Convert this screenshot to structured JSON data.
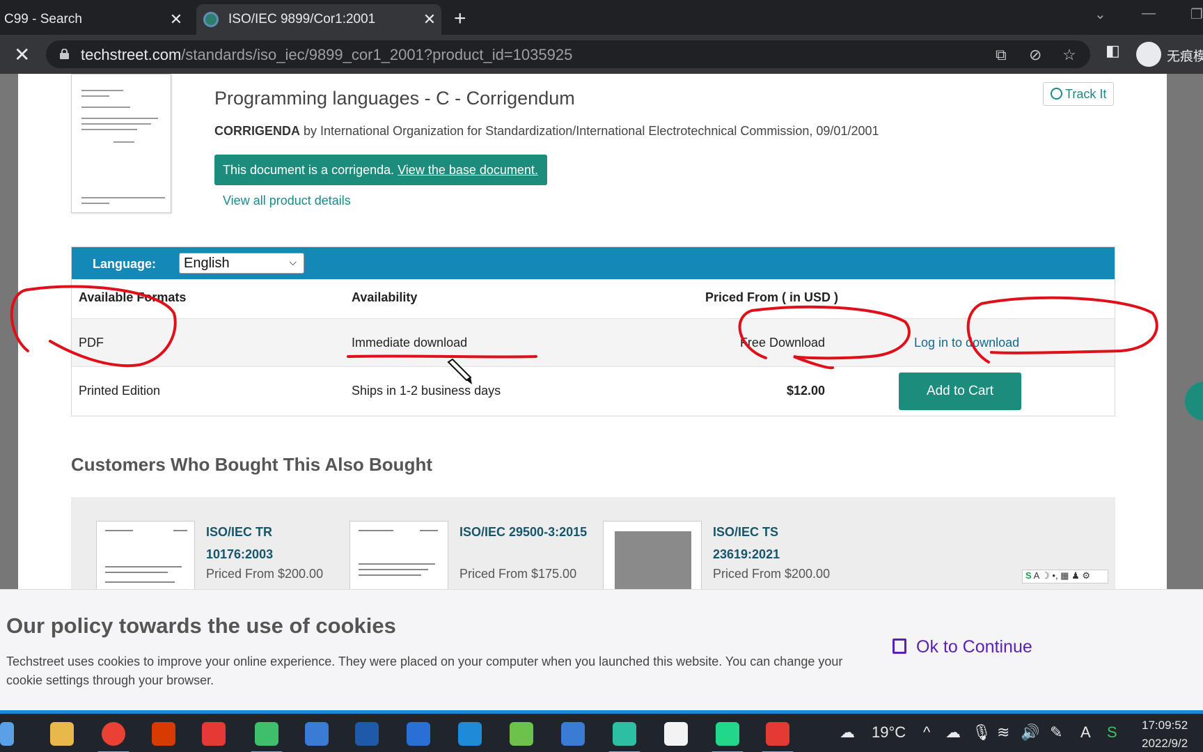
{
  "browser": {
    "tabs": [
      {
        "title": "C99 - Search",
        "active": false
      },
      {
        "title": "ISO/IEC 9899/Cor1:2001",
        "active": true
      }
    ],
    "url_host": "techstreet.com",
    "url_path": "/standards/iso_iec/9899_cor1_2001?product_id=1035925",
    "profile_label": "无痕模"
  },
  "product": {
    "title": "Programming languages - C - Corrigendum",
    "type": "CORRIGENDA",
    "byline": " by International Organization for Standardization/International Electrotechnical Commission, 09/01/2001",
    "banner_text": "This document is a corrigenda. ",
    "banner_link": "View the base document.",
    "details_link": "View all product details",
    "track_label": "Track It"
  },
  "formats": {
    "language_label": "Language:",
    "language_value": "English",
    "headers": [
      "Available Formats",
      "Availability",
      "Priced From ( in USD )"
    ],
    "rows": [
      {
        "format": "PDF",
        "availability": "Immediate download",
        "price": "Free Download",
        "action": "Log in to download"
      },
      {
        "format": "Printed Edition",
        "availability": "Ships in 1-2 business days",
        "price": "$12.00",
        "action": "Add to Cart"
      }
    ]
  },
  "also_bought": {
    "title": "Customers Who Bought This Also Bought",
    "items": [
      {
        "name": "ISO/IEC TR 10176:2003",
        "price": "Priced From $200.00"
      },
      {
        "name": "ISO/IEC 29500-3:2015",
        "price": "Priced From $175.00"
      },
      {
        "name": "ISO/IEC TS 23619:2021",
        "price": "Priced From $200.00"
      }
    ]
  },
  "cookie": {
    "title": "Our policy towards the use of cookies",
    "text": "Techstreet uses cookies to improve your online experience. They were placed on your computer when you launched this website. You can change your cookie settings through your browser.",
    "button": "Ok to Continue"
  },
  "taskbar": {
    "weather": "19°C",
    "time": "17:09:52",
    "date": "2022/9/2"
  },
  "colors": {
    "teal": "#1c8c7c",
    "language_bar": "#1489b8",
    "annotation_red": "#e0101a",
    "ok_purple": "#5a21b6"
  }
}
